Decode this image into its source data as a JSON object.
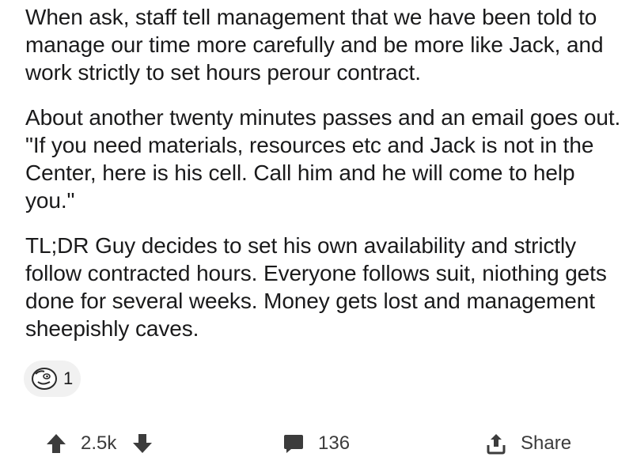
{
  "post": {
    "paragraphs": [
      "When ask, staff tell management that we have been told to manage our time more carefully and be more like Jack, and work strictly to set hours perour contract.",
      "About another twenty minutes passes and an email goes out. \"If you need materials, resources etc and Jack is not in the Center, here is his cell. Call him and he will come to help you.\"",
      "TL;DR Guy decides to set his own availability and strictly follow contracted hours. Everyone follows suit, niothing gets done for several weeks. Money gets lost and management sheepishly caves."
    ]
  },
  "awards": {
    "icon": "award-face-icon",
    "count": "1"
  },
  "actions": {
    "upvote_icon": "upvote-arrow-icon",
    "vote_count": "2.5k",
    "downvote_icon": "downvote-arrow-icon",
    "comment_icon": "comment-bubble-icon",
    "comment_count": "136",
    "share_icon": "share-upload-icon",
    "share_label": "Share"
  },
  "colors": {
    "text": "#1a1a1b",
    "icon": "#3c3c3c",
    "award_pill": "#f1f1f1"
  }
}
